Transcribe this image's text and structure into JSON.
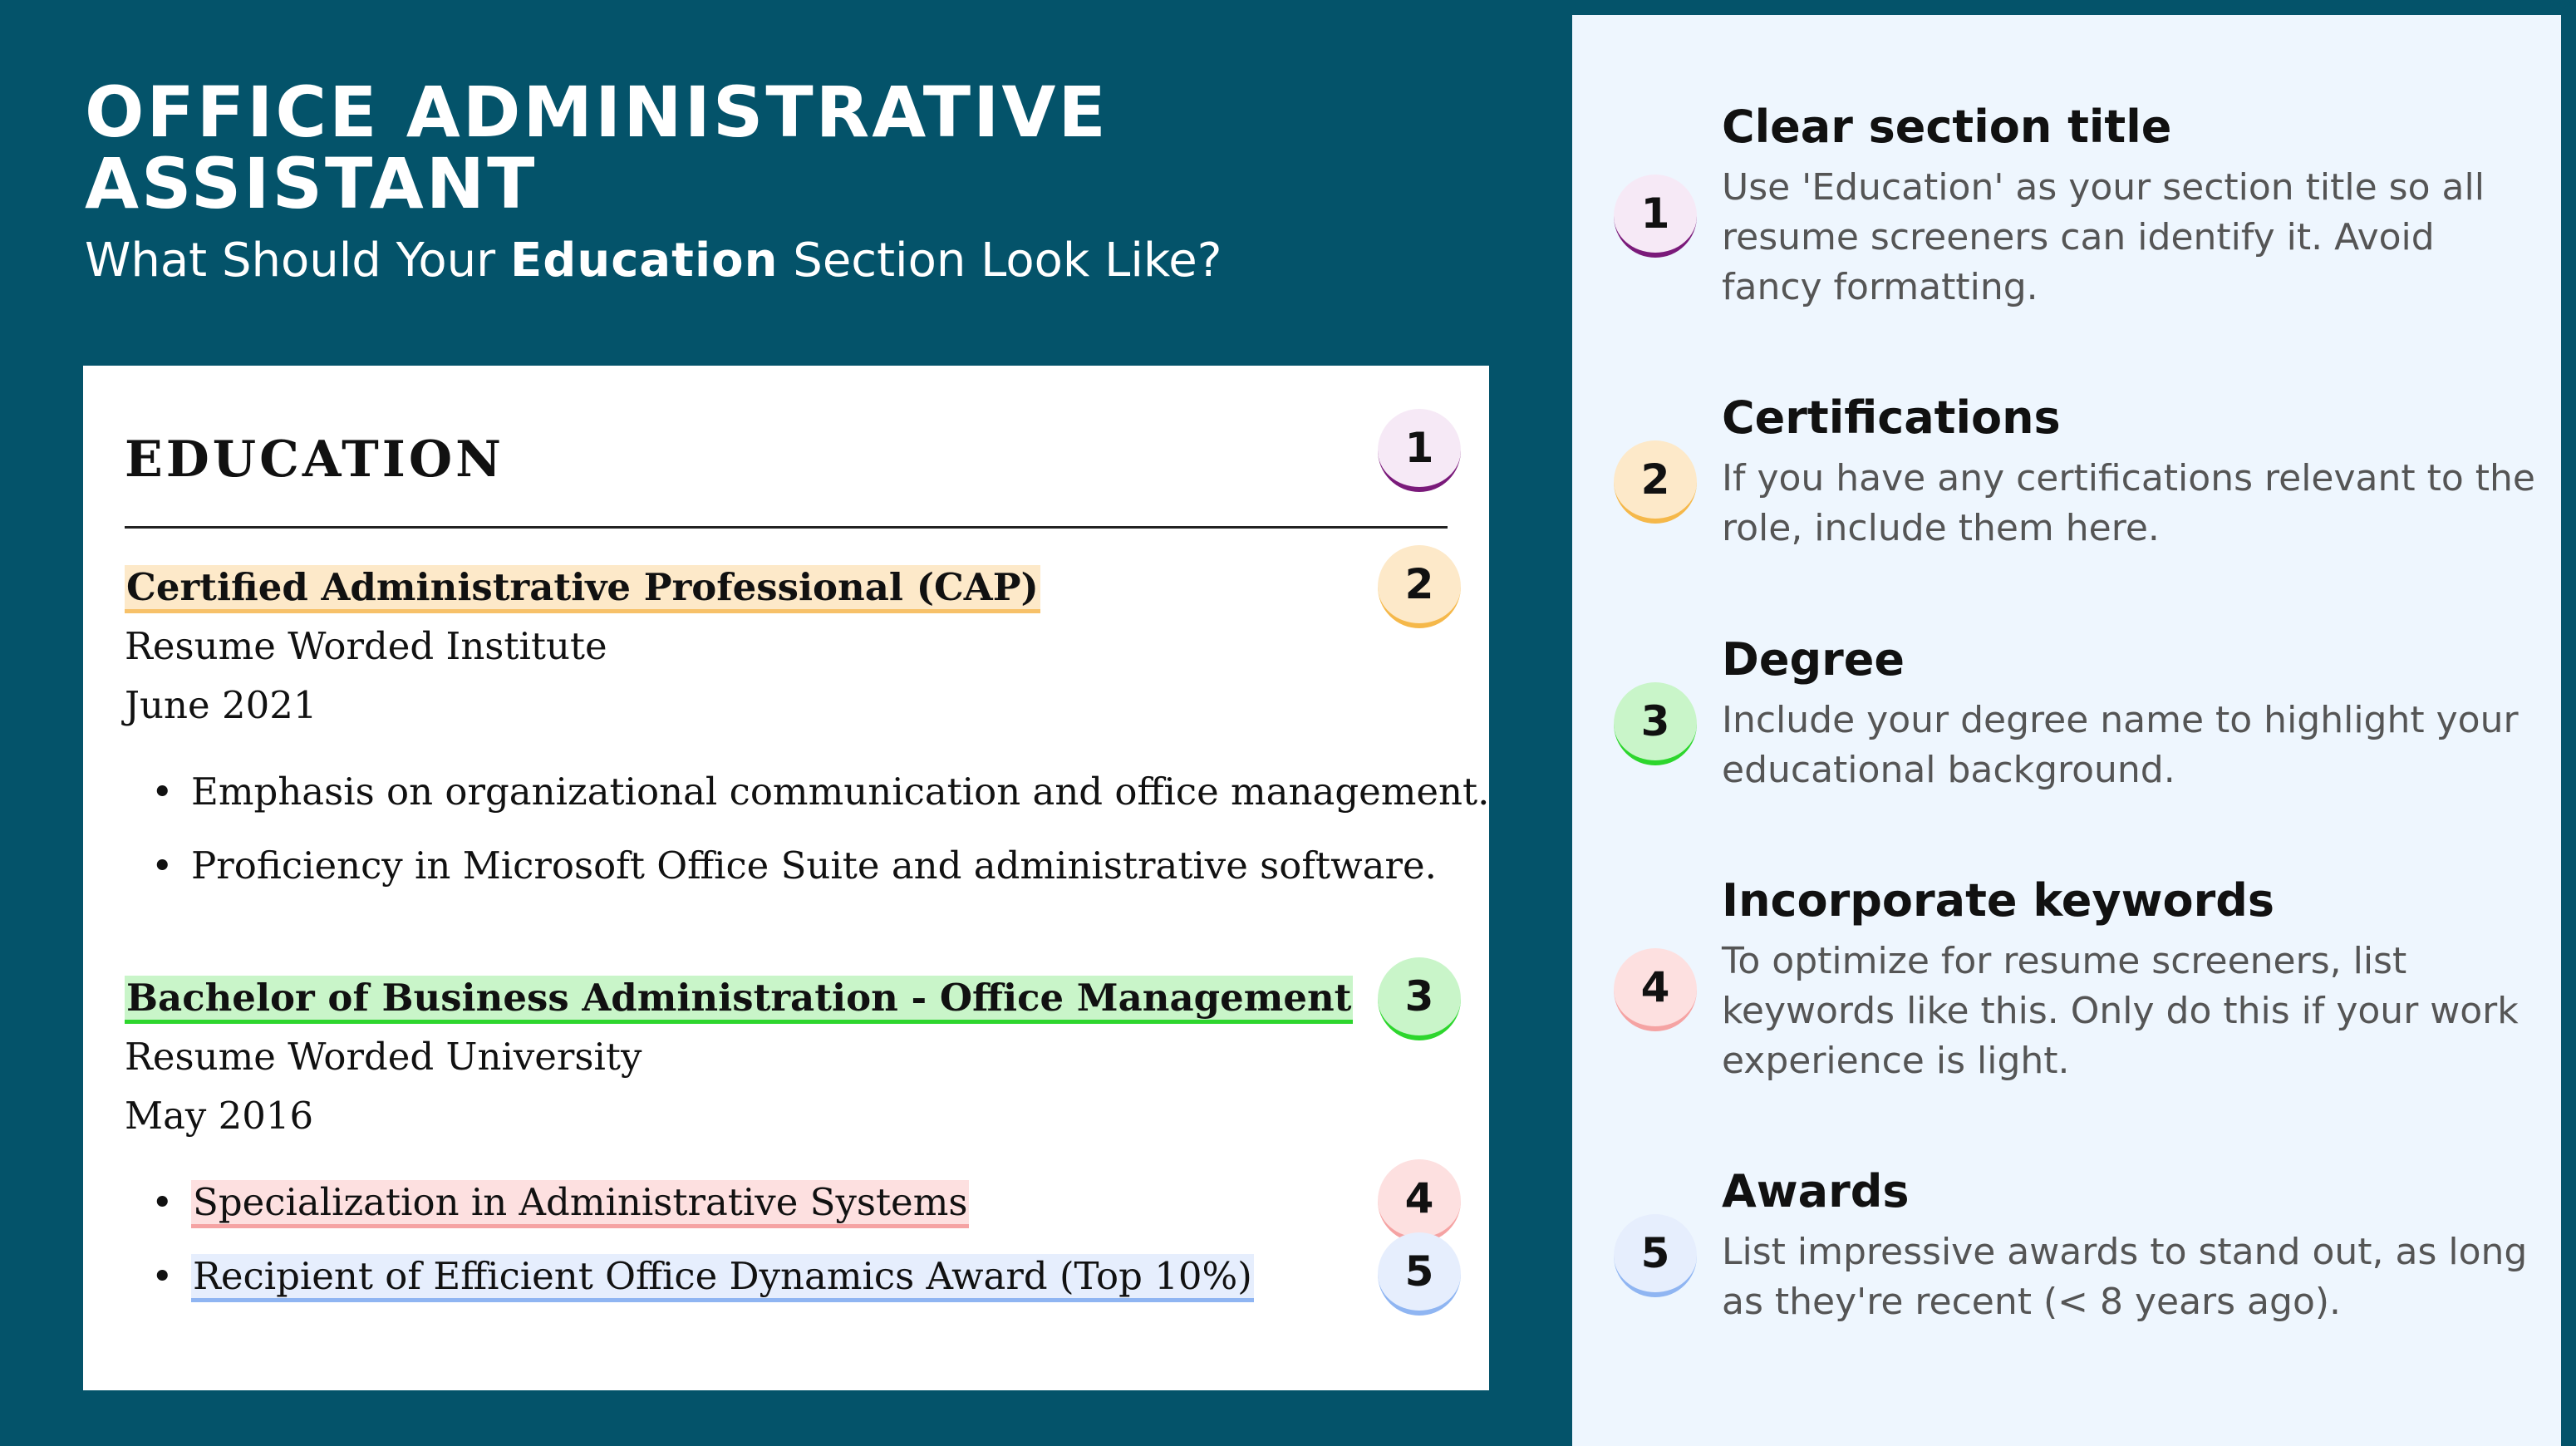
{
  "headline": {
    "title": "OFFICE ADMINISTRATIVE ASSISTANT",
    "subtitle_pre": "What Should Your ",
    "subtitle_bold": "Education",
    "subtitle_post": " Section Look Like?"
  },
  "resume": {
    "section_heading": "EDUCATION",
    "entries": [
      {
        "title": "Certified Administrative Professional (CAP)",
        "institution": "Resume Worded Institute",
        "date": "June 2021",
        "bullets": [
          "Emphasis on organizational communication and office management.",
          "Proficiency in Microsoft Office Suite and administrative software."
        ]
      },
      {
        "title": "Bachelor of Business Administration - Office Management",
        "institution": "Resume Worded University",
        "date": "May 2016",
        "bullets": [
          "Specialization in Administrative Systems",
          "Recipient of Efficient Office Dynamics Award (Top 10%)"
        ]
      }
    ],
    "bullet_glyph": "•"
  },
  "badges": [
    "1",
    "2",
    "3",
    "4",
    "5"
  ],
  "tips": [
    {
      "number": "1",
      "title": "Clear section title",
      "description": "Use 'Education' as your section title so all resume screeners can identify it. Avoid fancy formatting."
    },
    {
      "number": "2",
      "title": "Certifications",
      "description": "If you have any certifications relevant to the role, include them here."
    },
    {
      "number": "3",
      "title": "Degree",
      "description": "Include your degree name to highlight your educational background."
    },
    {
      "number": "4",
      "title": "Incorporate keywords",
      "description": "To optimize for resume screeners, list keywords like this. Only do this if your work experience is light."
    },
    {
      "number": "5",
      "title": "Awards",
      "description": "List impressive awards to stand out, as long as they're recent (< 8 years ago)."
    }
  ],
  "colors": {
    "background": "#04536a",
    "panel": "#eef6fe",
    "badge_1": "#7a1a7a",
    "badge_2": "#f5b84a",
    "badge_3": "#2dd62d",
    "badge_4": "#f5a3a3",
    "badge_5": "#8fb5f2"
  }
}
